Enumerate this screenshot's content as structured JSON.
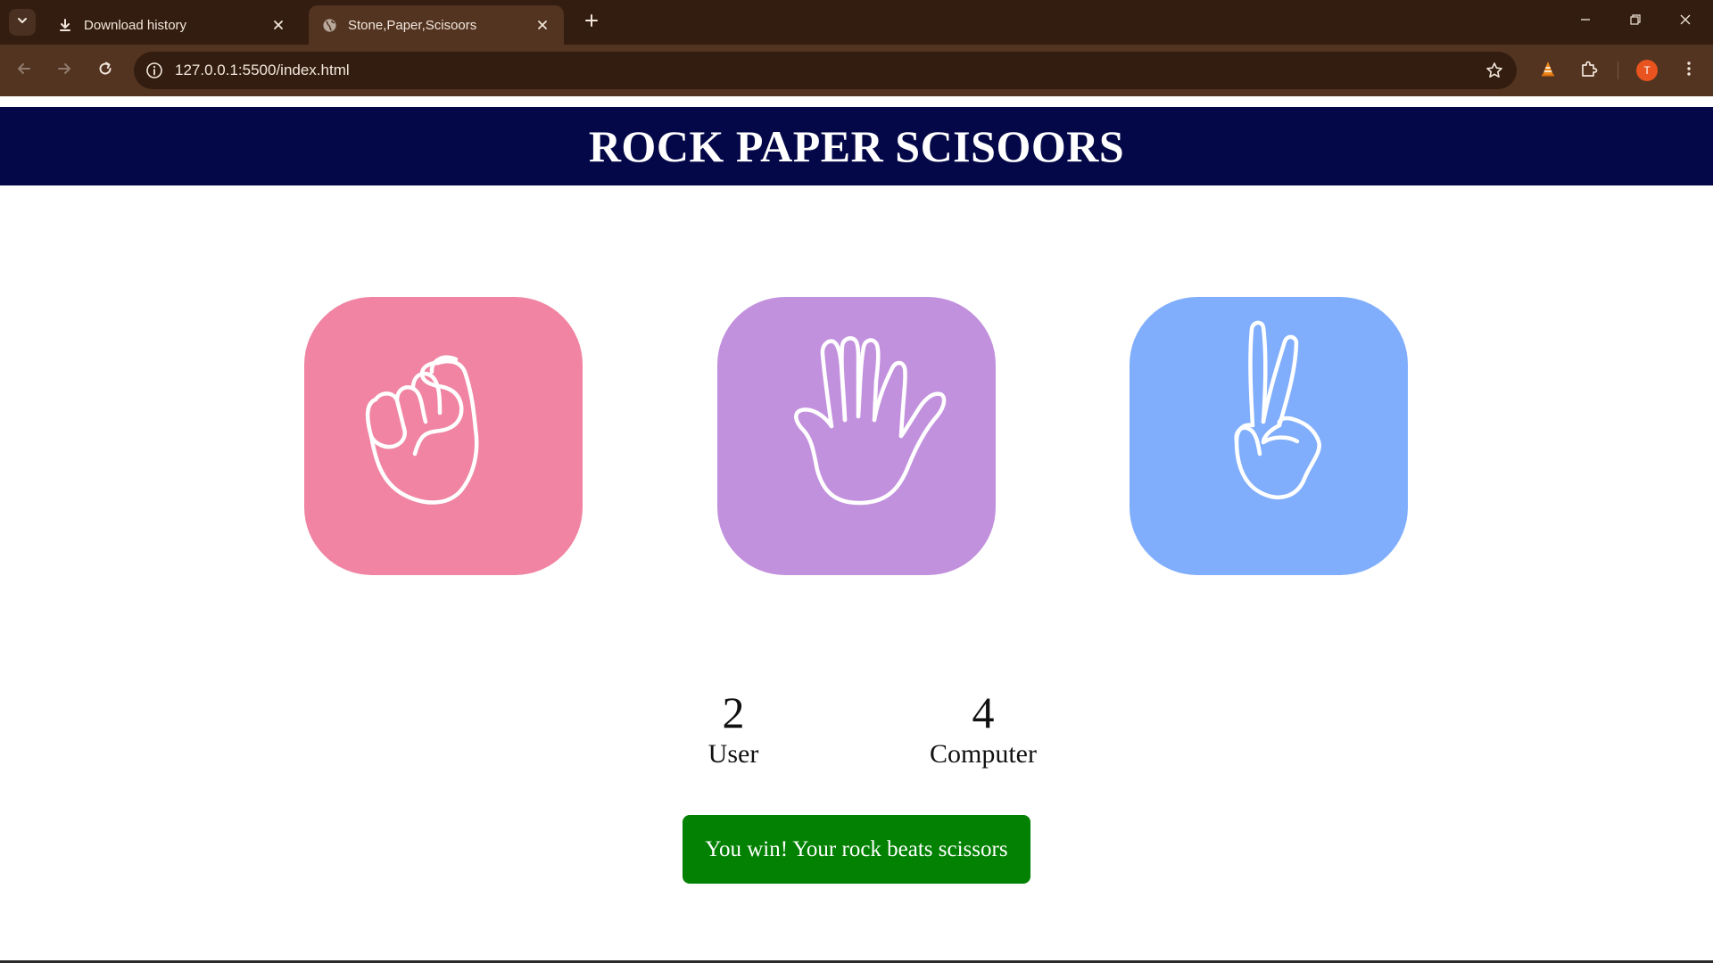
{
  "browser": {
    "tabs": [
      {
        "title": "Download history",
        "icon": "download-icon",
        "active": false
      },
      {
        "title": "Stone,Paper,Scisoors",
        "icon": "globe-icon",
        "active": true
      }
    ],
    "url": "127.0.0.1:5500/index.html",
    "profile_initial": "T",
    "colors": {
      "frame": "#331d10",
      "toolbar": "#523420",
      "text": "#f2e6dc",
      "avatar": "#e8531f"
    }
  },
  "page": {
    "title": "ROCK PAPER SCISOORS",
    "choices": [
      {
        "id": "rock",
        "icon": "fist-icon",
        "color": "#f084a2"
      },
      {
        "id": "paper",
        "icon": "open-hand-icon",
        "color": "#c291dd"
      },
      {
        "id": "scissors",
        "icon": "peace-hand-icon",
        "color": "#80aefc"
      }
    ],
    "score": {
      "user": {
        "value": "2",
        "label": "User"
      },
      "computer": {
        "value": "4",
        "label": "Computer"
      }
    },
    "message": "You win! Your rock beats scissors",
    "colors": {
      "header": "#040848",
      "message_bg": "#028102"
    }
  }
}
